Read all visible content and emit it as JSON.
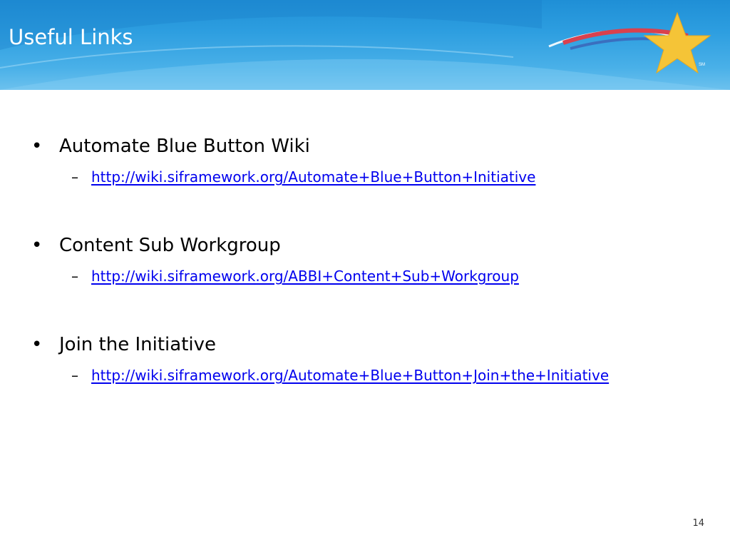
{
  "slide": {
    "title": "Useful Links",
    "page_number": "14",
    "logo_mark": "SM",
    "colors": {
      "header_blue": "#2d9ee0",
      "link": "#0000ee",
      "star": "#f5c437",
      "stripe_red": "#d9414e"
    }
  },
  "items": [
    {
      "bullet": "•",
      "heading": "Automate Blue Button Wiki",
      "dash": "–",
      "link": "http://wiki.siframework.org/Automate+Blue+Button+Initiative"
    },
    {
      "bullet": "•",
      "heading": "Content Sub Workgroup",
      "dash": "–",
      "link": "http://wiki.siframework.org/ABBI+Content+Sub+Workgroup"
    },
    {
      "bullet": "•",
      "heading": "Join the Initiative",
      "dash": "–",
      "link": "http://wiki.siframework.org/Automate+Blue+Button+Join+the+Initiative"
    }
  ]
}
